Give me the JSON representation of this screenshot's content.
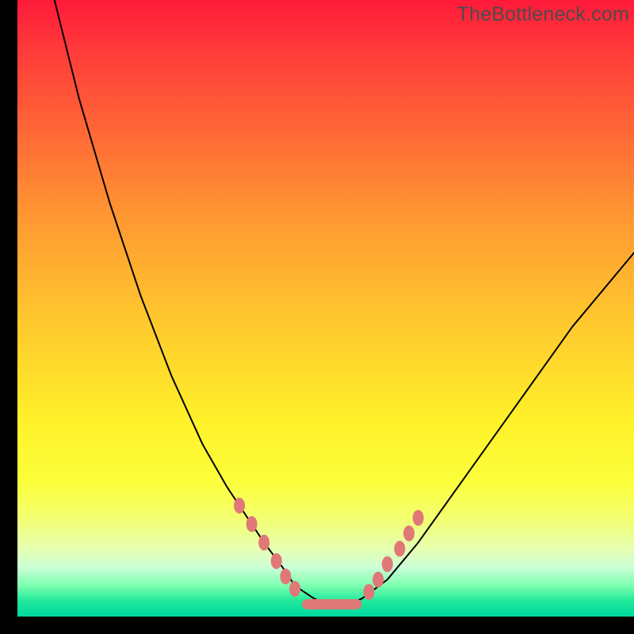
{
  "watermark": "TheBottleneck.com",
  "chart_data": {
    "type": "line",
    "title": "",
    "xlabel": "",
    "ylabel": "",
    "xlim": [
      0,
      100
    ],
    "ylim": [
      0,
      100
    ],
    "series": [
      {
        "name": "bottleneck-curve",
        "x": [
          6,
          10,
          15,
          20,
          25,
          30,
          34,
          36,
          38,
          40,
          43,
          45,
          48,
          50,
          54,
          56,
          60,
          65,
          70,
          75,
          80,
          85,
          90,
          95,
          100
        ],
        "y": [
          100,
          84,
          67,
          52,
          39,
          28,
          21,
          18,
          15,
          12,
          8,
          5,
          3,
          2,
          2,
          3,
          6,
          12,
          19,
          26,
          33,
          40,
          47,
          53,
          59
        ]
      }
    ],
    "highlight_points_left": [
      {
        "x": 36,
        "y": 18
      },
      {
        "x": 38,
        "y": 15
      },
      {
        "x": 40,
        "y": 12
      },
      {
        "x": 42,
        "y": 9
      },
      {
        "x": 43.5,
        "y": 6.5
      },
      {
        "x": 45,
        "y": 4.5
      }
    ],
    "highlight_points_right": [
      {
        "x": 57,
        "y": 4
      },
      {
        "x": 58.5,
        "y": 6
      },
      {
        "x": 60,
        "y": 8.5
      },
      {
        "x": 62,
        "y": 11
      },
      {
        "x": 63.5,
        "y": 13.5
      },
      {
        "x": 65,
        "y": 16
      }
    ],
    "flat_segment": {
      "x0": 47,
      "x1": 55,
      "y": 2
    }
  }
}
